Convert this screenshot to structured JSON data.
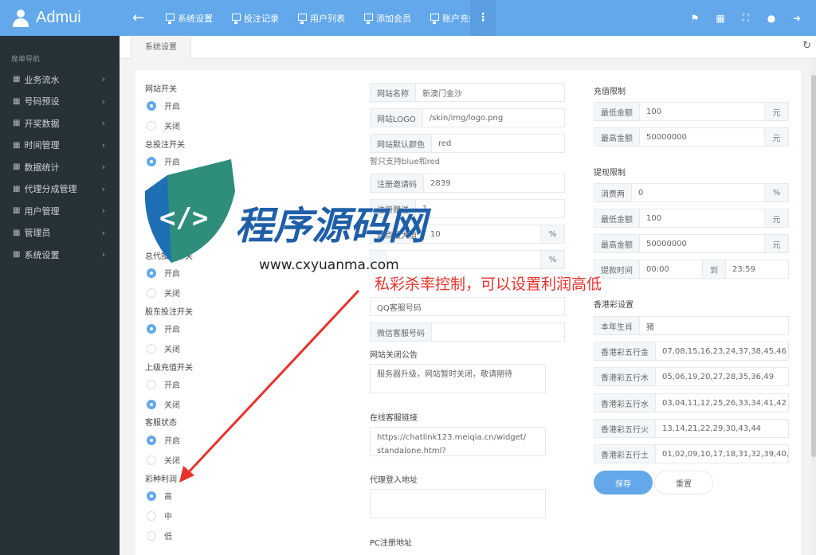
{
  "brand": {
    "name": "Admui"
  },
  "topnav": {
    "links": [
      "系统设置",
      "投注记录",
      "用户列表",
      "添加会员",
      "账户充值"
    ]
  },
  "sidebar": {
    "title": "席单导航",
    "items": [
      "业务流水",
      "号码预设",
      "开奖数据",
      "时间管理",
      "数据统计",
      "代理分成管理",
      "用户管理",
      "管理员",
      "系统设置"
    ]
  },
  "tabs": {
    "active": "系统设置"
  },
  "switches": {
    "website_switch": {
      "label": "网站开关",
      "opt_on": "开启",
      "opt_off": "关闭",
      "selected": "on"
    },
    "total_bet_switch": {
      "label": "总投注开关",
      "opt_on": "开启"
    },
    "agent_bet_switch": {
      "label": "总代投注开关",
      "opt_on": "开启",
      "opt_off": "关闭",
      "selected": "on"
    },
    "shareholder_switch": {
      "label": "股东投注开关",
      "opt_on": "开启",
      "opt_off": "关闭",
      "selected": "on"
    },
    "upper_recharge_switch": {
      "label": "上级充值开关",
      "opt_on": "开启",
      "opt_off": "关闭",
      "selected": "off"
    },
    "customer_status": {
      "label": "客服状态",
      "opt_on": "开启",
      "opt_off": "关闭",
      "selected": "on"
    },
    "profit": {
      "label": "彩种利润",
      "opt_high": "高",
      "opt_mid": "中",
      "opt_low": "低",
      "selected": "high"
    }
  },
  "site": {
    "name_label": "网站名称",
    "name_value": "新澳门金沙",
    "logo_label": "网站LOGO",
    "logo_value": "/skin/img/logo.png",
    "color_label": "网站默认颜色",
    "color_value": "red",
    "color_hint": "暂只支持blue和red",
    "invite_label": "注册邀请码",
    "invite_value": "2839",
    "gift_label": "注册赠送",
    "gift_value": "1",
    "rebate_label": "返点最大值",
    "rebate_value": "10",
    "rebate_suffix": "%",
    "pct_suffix": "%",
    "qq_placeholder": "QQ客服号码",
    "wechat_label": "微信客服号码",
    "notice_label": "网站关闭公告",
    "notice_value": "服务器升级，网站暂时关闭，敬请期待",
    "online_label": "在线客服链接",
    "online_value": "https://chatlink123.meiqia.cn/widget/standalone.html?",
    "agent_login_label": "代理登入地址",
    "pc_reg_label": "PC注册地址"
  },
  "recharge": {
    "title": "充值限制",
    "min_label": "最低金额",
    "min_value": "100",
    "min_unit": "元",
    "max_label": "最高金额",
    "max_value": "50000000",
    "max_unit": "元"
  },
  "withdraw": {
    "title": "提现限制",
    "fee_label": "消费两",
    "fee_value": "0",
    "fee_unit": "%",
    "min_label": "最低金额",
    "min_value": "100",
    "min_unit": "元",
    "max_label": "最高金额",
    "max_value": "50000000",
    "max_unit": "元",
    "time_label": "提款时间",
    "time_start": "00:00",
    "time_to": "到",
    "time_end": "23:59"
  },
  "hk": {
    "title": "香港彩设置",
    "zodiac_label": "本年生肖",
    "zodiac_value": "猪",
    "metal_label": "香港彩五行金",
    "metal_value": "07,08,15,16,23,24,37,38,45,46",
    "wood_label": "香港彩五行木",
    "wood_value": "05,06,19,20,27,28,35,36,49",
    "water_label": "香港彩五行水",
    "water_value": "03,04,11,12,25,26,33,34,41,42",
    "fire_label": "香港彩五行火",
    "fire_value": "13,14,21,22,29,30,43,44",
    "earth_label": "香港彩五行土",
    "earth_value": "01,02,09,10,17,18,31,32,39,40,"
  },
  "buttons": {
    "save": "保存",
    "reset": "重置"
  },
  "watermark": {
    "logo_text": "程序源码网",
    "url": "www.cxyuanma.com",
    "annotation": "私彩杀率控制，可以设置利润高低"
  },
  "colors": {
    "accent": "#62a8ea",
    "sidebar": "#263238",
    "annotation": "#e8322c"
  }
}
